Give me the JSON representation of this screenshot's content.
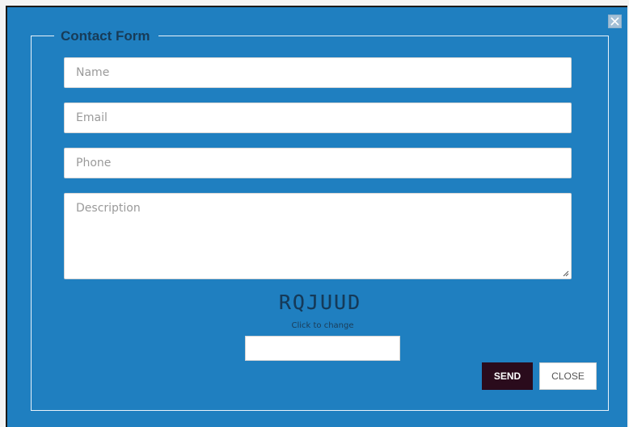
{
  "modal": {
    "legend": "Contact Form",
    "close_icon": "close-x-icon",
    "fields": {
      "name_placeholder": "Name",
      "email_placeholder": "Email",
      "phone_placeholder": "Phone",
      "description_placeholder": "Description"
    },
    "captcha": {
      "code": "RQJUUD",
      "hint": "Click to change",
      "input_value": ""
    },
    "buttons": {
      "send_label": "SEND",
      "close_label": "CLOSE"
    }
  },
  "colors": {
    "modal_background": "#1f7fc0",
    "send_button": "#2a0b1c",
    "legend_text": "#173b57"
  }
}
